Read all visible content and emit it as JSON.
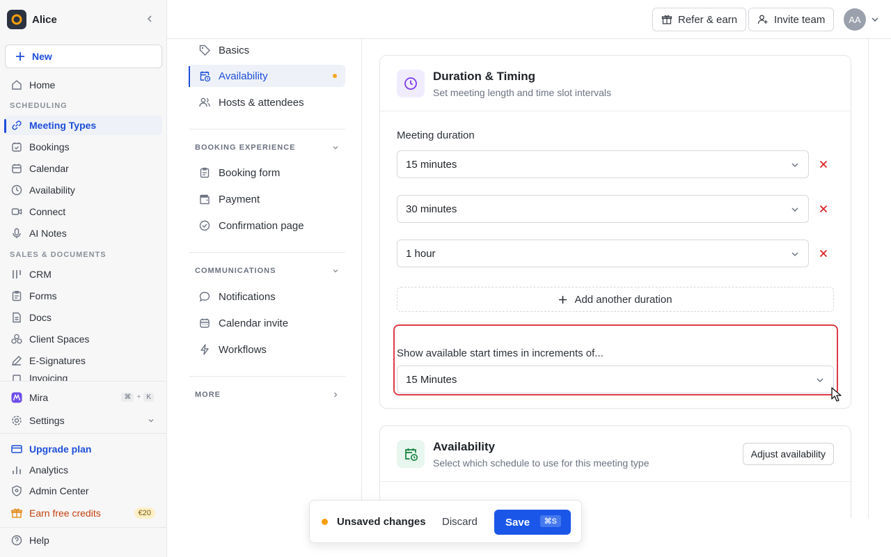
{
  "workspace": {
    "name": "Alice"
  },
  "sidebar": {
    "new_label": "New",
    "home": "Home",
    "section_scheduling": "SCHEDULING",
    "scheduling_items": [
      "Meeting Types",
      "Bookings",
      "Calendar",
      "Availability",
      "Connect",
      "AI Notes"
    ],
    "section_sales": "SALES & DOCUMENTS",
    "sales_items": [
      "CRM",
      "Forms",
      "Docs",
      "Client Spaces",
      "E-Signatures",
      "Invoicing"
    ],
    "mira": "Mira",
    "mira_shortcut": [
      "⌘",
      "+",
      "K"
    ],
    "settings": "Settings",
    "upgrade": "Upgrade plan",
    "analytics": "Analytics",
    "admin": "Admin Center",
    "credits": "Earn free credits",
    "credits_badge": "€20",
    "help": "Help",
    "colors": {
      "accent": "#1d4ed8",
      "credits": "#c2410c"
    }
  },
  "topbar": {
    "refer": "Refer & earn",
    "invite": "Invite team",
    "avatar_initials": "AA"
  },
  "subnav": {
    "items_top": [
      "Basics",
      "Availability",
      "Hosts & attendees"
    ],
    "section_booking": "BOOKING EXPERIENCE",
    "booking_items": [
      "Booking form",
      "Payment",
      "Confirmation page"
    ],
    "section_comms": "COMMUNICATIONS",
    "comms_items": [
      "Notifications",
      "Calendar invite",
      "Workflows"
    ],
    "section_more": "MORE"
  },
  "duration_card": {
    "title": "Duration & Timing",
    "subtitle": "Set meeting length and time slot intervals",
    "duration_label": "Meeting duration",
    "durations": [
      "15 minutes",
      "30 minutes",
      "1 hour"
    ],
    "add_label": "Add another duration",
    "increments_label": "Show available start times in increments of...",
    "increment_value": "15 Minutes"
  },
  "availability_card": {
    "title": "Availability",
    "subtitle": "Select which schedule to use for this meeting type",
    "adjust_label": "Adjust availability"
  },
  "unsaved_bar": {
    "text": "Unsaved changes",
    "discard": "Discard",
    "save": "Save",
    "save_shortcut": "⌘S"
  }
}
